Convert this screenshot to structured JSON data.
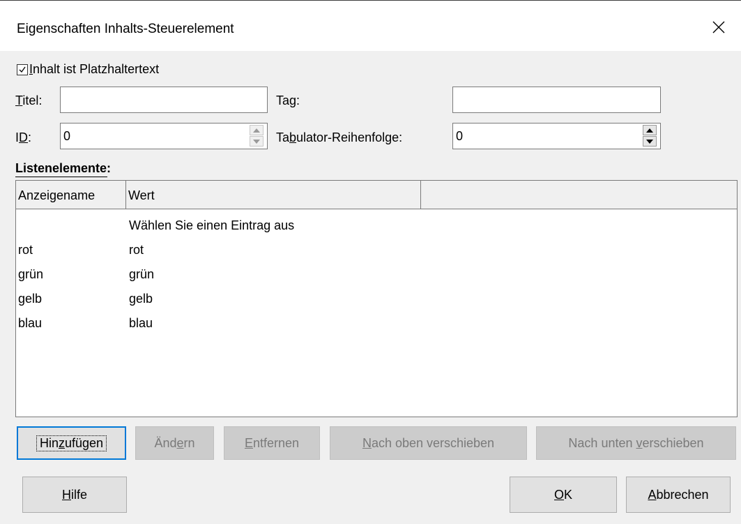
{
  "window": {
    "title": "Eigenschaften Inhalts-Steuerelement"
  },
  "checkbox": {
    "checked": true,
    "label_mnemonic": "I",
    "label_rest": "nhalt ist Platzhaltertext"
  },
  "fields": {
    "titel": {
      "mnemonic": "T",
      "rest": "itel:",
      "value": ""
    },
    "tag": {
      "pre": "Ta",
      "mnemonic": "g",
      "rest": ":",
      "value": ""
    },
    "id": {
      "pre": "I",
      "mnemonic": "D",
      "rest": ":",
      "value": "0"
    },
    "tab_order": {
      "pre": "Ta",
      "mnemonic": "b",
      "rest": "ulator-Reihenfolge:",
      "value": "0"
    }
  },
  "list": {
    "heading": "Listenelemente:",
    "columns": [
      "Anzeigename",
      "Wert",
      ""
    ],
    "rows": [
      {
        "name": "",
        "value": "Wählen Sie einen Eintrag aus"
      },
      {
        "name": "rot",
        "value": "rot"
      },
      {
        "name": "grün",
        "value": "grün"
      },
      {
        "name": "gelb",
        "value": "gelb"
      },
      {
        "name": "blau",
        "value": "blau"
      }
    ]
  },
  "buttons": {
    "add": {
      "pre": "Hin",
      "mnemonic": "z",
      "rest": "ufügen"
    },
    "change": {
      "pre": "Änd",
      "mnemonic": "e",
      "rest": "rn"
    },
    "remove": {
      "pre": "",
      "mnemonic": "E",
      "rest": "ntfernen"
    },
    "move_up": {
      "pre": "",
      "mnemonic": "N",
      "rest": "ach oben verschieben"
    },
    "move_down": {
      "pre": "Nach unten ",
      "mnemonic": "v",
      "rest": "erschieben"
    },
    "help": {
      "pre": "",
      "mnemonic": "H",
      "rest": "ilfe"
    },
    "ok": {
      "pre": "",
      "mnemonic": "O",
      "rest": "K"
    },
    "cancel": {
      "pre": "",
      "mnemonic": "A",
      "rest": "bbrechen"
    }
  },
  "icons": {
    "close": "close-icon",
    "checkmark": "checkmark-icon",
    "spin_up": "spin-up-icon",
    "spin_down": "spin-down-icon"
  },
  "colors": {
    "dialog_bg": "#f0f0f0",
    "focus_border": "#0078d7",
    "disabled_button": "#cccccc"
  }
}
